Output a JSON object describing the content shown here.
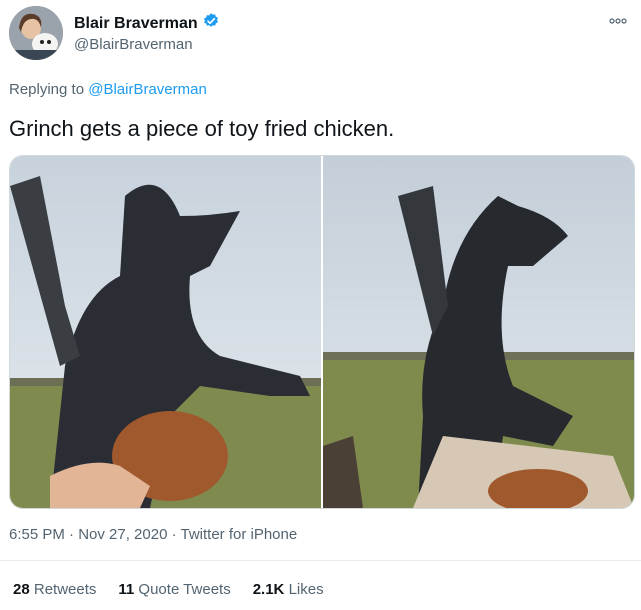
{
  "author": {
    "name": "Blair Braverman",
    "handle": "@BlairBraverman",
    "verified": true
  },
  "more_icon": "more-icon",
  "reply": {
    "prefix": "Replying to",
    "mention": "@BlairBraverman"
  },
  "tweet": {
    "text": "Grinch gets a piece of toy fried chicken."
  },
  "media": {
    "photos": [
      "photo-1",
      "photo-2"
    ]
  },
  "meta": {
    "timestamp": "6:55 PM · Nov 27, 2020 · Twitter for iPhone"
  },
  "stats": {
    "retweets_count": "28",
    "retweets_label": "Retweets",
    "quotes_count": "11",
    "quotes_label": "Quote Tweets",
    "likes_count": "2.1K",
    "likes_label": "Likes"
  },
  "colors": {
    "link": "#1d9bf0",
    "muted": "#536471",
    "text": "#0f1419"
  }
}
